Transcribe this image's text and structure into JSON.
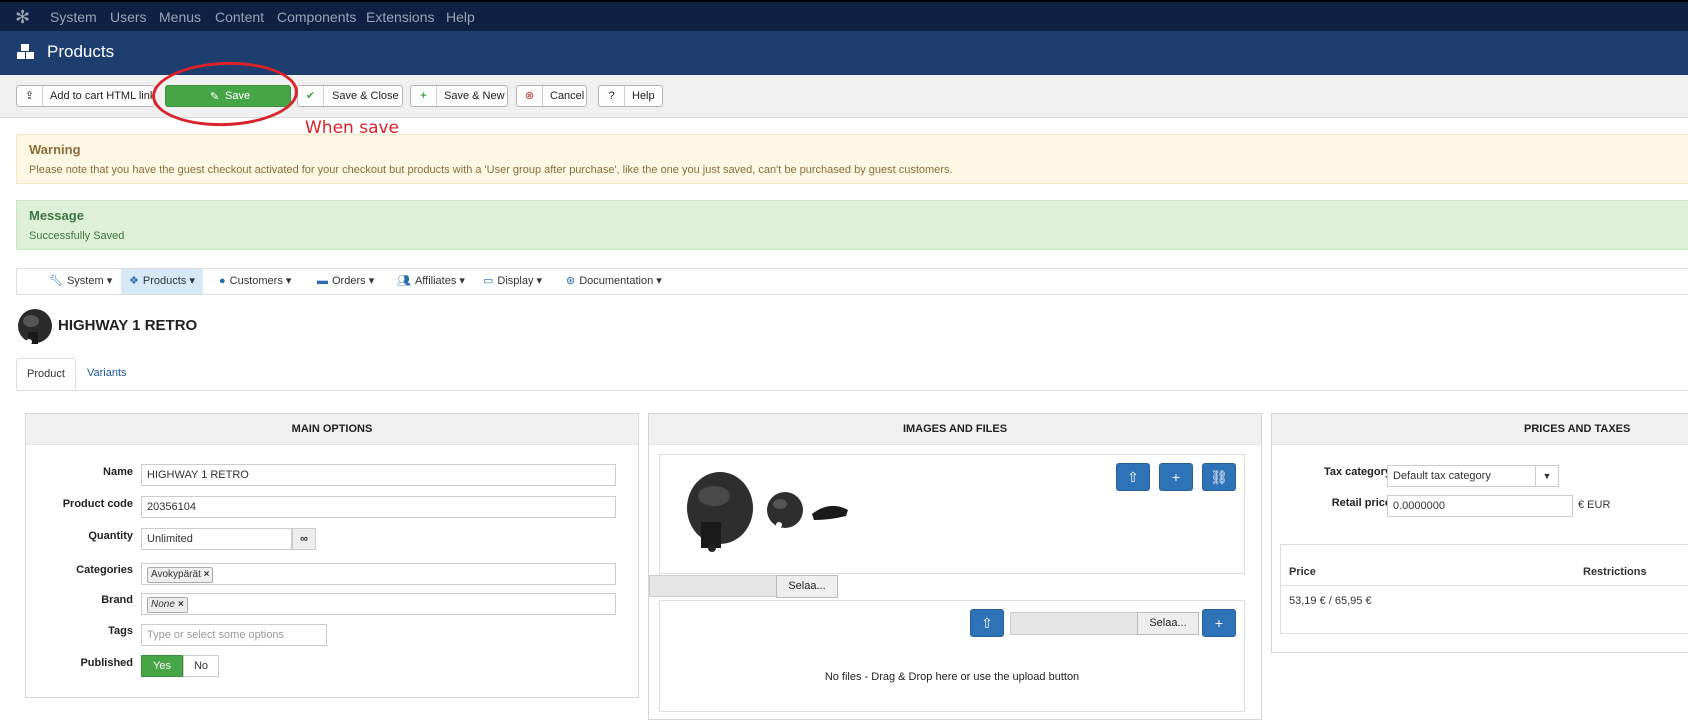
{
  "topmenu": [
    "System",
    "Users",
    "Menus",
    "Content",
    "Components",
    "Extensions",
    "Help"
  ],
  "header": {
    "title": "Products"
  },
  "toolbar": {
    "add_to_cart": "Add to cart HTML link",
    "save": "Save",
    "save_close": "Save & Close",
    "save_new": "Save & New",
    "cancel": "Cancel",
    "help": "Help"
  },
  "annotation": "When save",
  "warning": {
    "title": "Warning",
    "text": "Please note that you have the guest checkout activated for your checkout but products with a 'User group after purchase', like the one you just saved, can't be purchased by guest customers."
  },
  "message": {
    "title": "Message",
    "text": "Successfully Saved"
  },
  "nav": [
    "System",
    "Products",
    "Customers",
    "Orders",
    "Affiliates",
    "Display",
    "Documentation"
  ],
  "product": {
    "title": "HIGHWAY 1 RETRO"
  },
  "tabs": {
    "product": "Product",
    "variants": "Variants"
  },
  "main_options": {
    "header": "MAIN OPTIONS",
    "name_label": "Name",
    "name_value": "HIGHWAY 1 RETRO",
    "code_label": "Product code",
    "code_value": "20356104",
    "qty_label": "Quantity",
    "qty_value": "Unlimited",
    "cat_label": "Categories",
    "cat_value": "Avokypärät",
    "brand_label": "Brand",
    "brand_value": "None",
    "tags_label": "Tags",
    "tags_placeholder": "Type or select some options",
    "published_label": "Published",
    "yes": "Yes",
    "no": "No"
  },
  "images": {
    "header": "IMAGES AND FILES",
    "browse": "Selaa...",
    "browse2": "Selaa...",
    "nofiles": "No files - Drag & Drop here or use the upload button"
  },
  "prices": {
    "header": "PRICES AND TAXES",
    "tax_label": "Tax category",
    "tax_value": "Default tax category",
    "retail_label": "Retail price",
    "retail_value": "0.0000000",
    "currency": "€ EUR",
    "col_price": "Price",
    "col_restrictions": "Restrictions",
    "price_row": "53,19 € / 65,95 €"
  }
}
